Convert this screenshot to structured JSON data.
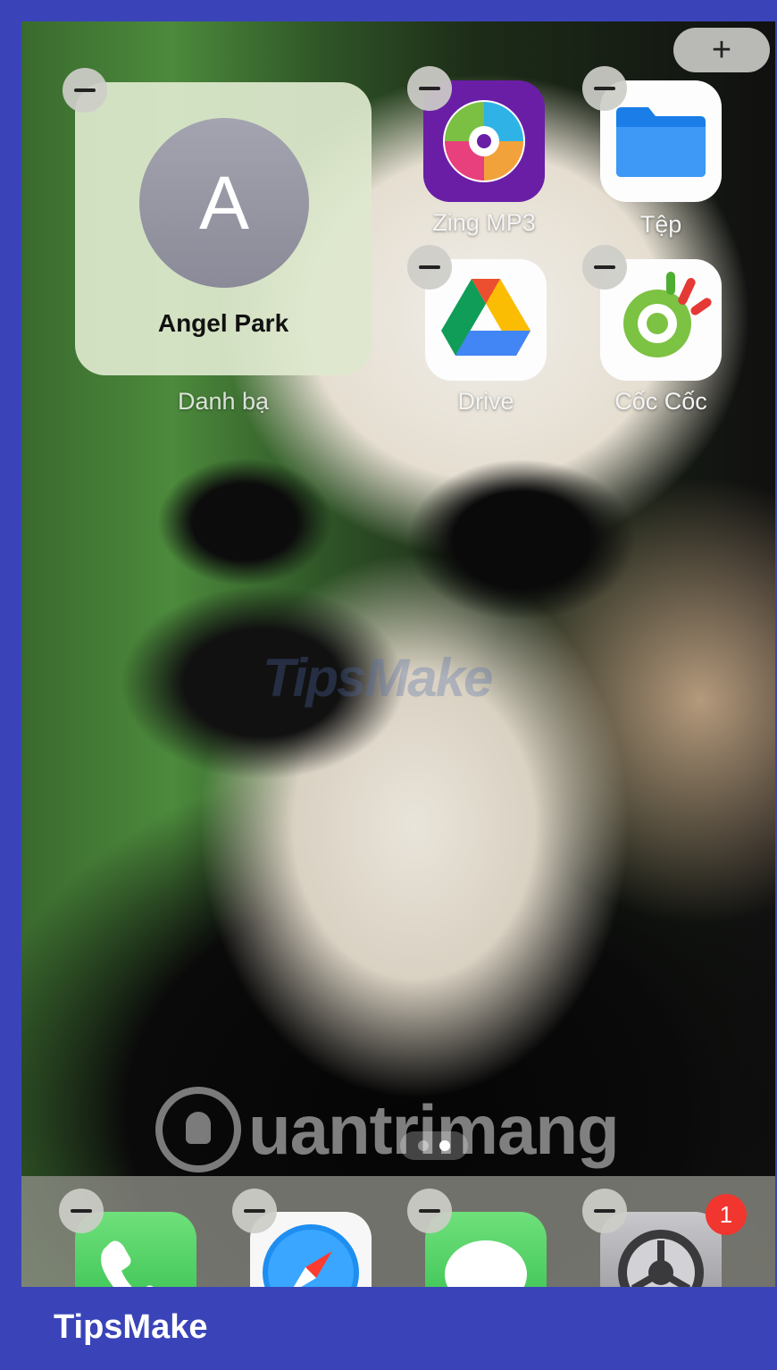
{
  "toolbar": {
    "add_label": "+"
  },
  "widget": {
    "initial": "A",
    "name": "Angel Park",
    "label": "Danh bạ"
  },
  "apps": [
    {
      "label": "Zing MP3",
      "icon": "zing-mp3-icon"
    },
    {
      "label": "Tệp",
      "icon": "files-folder-icon"
    },
    {
      "label": "Drive",
      "icon": "google-drive-icon"
    },
    {
      "label": "Cốc Cốc",
      "icon": "coc-coc-browser-icon"
    }
  ],
  "dock": {
    "apps": [
      {
        "name": "Phone",
        "icon": "phone-icon"
      },
      {
        "name": "Safari",
        "icon": "safari-compass-icon"
      },
      {
        "name": "Messages",
        "icon": "messages-bubble-icon"
      },
      {
        "name": "Settings",
        "icon": "settings-gear-icon"
      }
    ],
    "settings_badge": "1"
  },
  "page_indicator": {
    "pages": 2,
    "current": 2
  },
  "watermarks": {
    "center": "TipsMake",
    "bottom": "uantrimang"
  },
  "footer": {
    "brand": "TipsMake"
  },
  "colors": {
    "frame": "#3a44b8",
    "badge": "#f0362e",
    "widget_bg": "#dee8cd",
    "zing": "#6a1ea6"
  }
}
